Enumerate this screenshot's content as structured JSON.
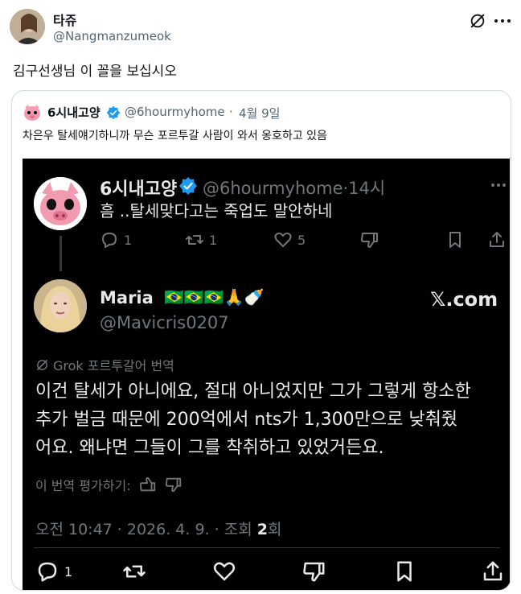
{
  "tweet": {
    "author_name": "타쥬",
    "author_handle": "@Nangmanzumeok",
    "text": "김구선생님 이 꼴을 보십시오"
  },
  "quote": {
    "author_name": "6시내고양",
    "author_handle": "@6hourmyhome",
    "separator": "·",
    "date": "4월 9일",
    "text": "차은우 탈세얘기하니까 무슨 포르투갈 사람이 와서 옹호하고 있음"
  },
  "embedded": {
    "reply_to": {
      "author_name": "6시내고양",
      "author_handle": "@6hourmyhome·14시",
      "text": "흠 ..탈세맞다고는 죽업도 말안하네",
      "reply_count": "1",
      "retweet_count": "1",
      "like_count": "5"
    },
    "main": {
      "author_name": "Maria",
      "author_emojis": "🇧🇷🇧🇷🇧🇷🙏🍼",
      "author_handle": "@Mavicris0207",
      "brand": "𝕏.com",
      "grok_label": "Grok 포르투갈어 번역",
      "body_lines": [
        "이건 탈세가 아니에요, 절대 아니었지만 그가 그렇게 항소한",
        "추가 벌금 때문에 200억에서 nts가 1,300만으로 낮춰줬",
        "어요. 왜냐면 그들이 그를 착취하고 있었거든요."
      ],
      "rate_label": "이 번역 평가하기:",
      "meta_prefix": "오전 10:47 · 2026. 4. 9. · 조회 ",
      "meta_views": "2",
      "meta_suffix": "회",
      "reply_count": "1"
    }
  },
  "colors": {
    "text_primary": "#0f1419",
    "text_secondary": "#536471",
    "verified": "#1d9bf0",
    "dark_bg": "#000000",
    "dark_text": "#e7e9ea",
    "dark_muted": "#71767b"
  }
}
